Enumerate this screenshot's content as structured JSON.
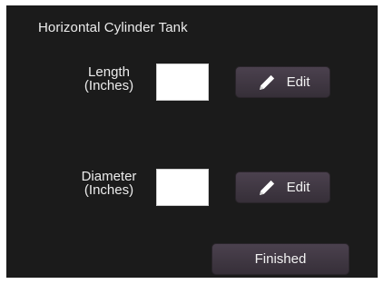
{
  "title": "Horizontal Cylinder Tank",
  "fields": {
    "length": {
      "label": "Length\n(Inches)",
      "value": "",
      "edit_label": "Edit",
      "edit_icon": "pencil-icon"
    },
    "diameter": {
      "label": "Diameter\n(Inches)",
      "value": "",
      "edit_label": "Edit",
      "edit_icon": "pencil-icon"
    }
  },
  "finished_label": "Finished",
  "colors": {
    "panel_background": "#1b1b1b",
    "button_background": "#413843",
    "text": "#ececec"
  }
}
